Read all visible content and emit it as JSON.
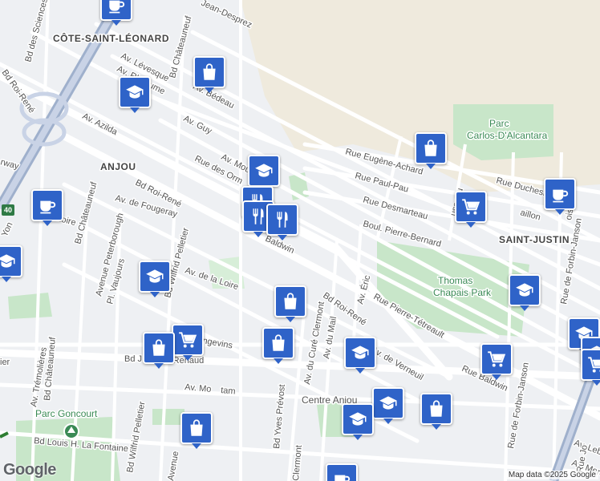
{
  "neighbourhoods": {
    "cote_saint_leonard": "CÔTE-SAINT-LÉONARD",
    "anjou": "ANJOU",
    "saint_justin": "SAINT-JUSTIN"
  },
  "parks": {
    "alcantara": "Parc\nCarlos-D'Alcantara",
    "thomas_chapais": "Thomas\nChapais Park",
    "goncourt": "Parc Goncourt",
    "centre_anjou": "Centre Anjou"
  },
  "streets": {
    "jean_desprez": "Jean-Desprez",
    "bd_sciences": "Bd des Sciences",
    "bd_chateauneuf_top": "Bd Châteauneuf",
    "av_levesque": "Av. Lévesque",
    "av_rheaume": "Av. Rhéaume",
    "av_bedeau": "Av. Bédeau",
    "bd_roi_rene_left": "Bd Roi-René",
    "av_azilda": "Av. Azilda",
    "av_guy": "Av. Guy",
    "av_mou": "Av. Mou",
    "rue_eugene_achard": "Rue Eugène-Achard",
    "rue_paul_pau": "Rue Paul-Pau",
    "rue_duchesne": "Rue Duchesn",
    "rue_desmarteau": "Rue Desmarteau",
    "bailon": "aillon",
    "usseau": "usseau",
    "boul_pierre_bernard": "Boul. Pierre-Bernard",
    "rue_des_orm": "Rue des Orm",
    "bd_roi_rene_mid": "Bd Roi-René",
    "highway": "rway",
    "anjou_small": "Yon",
    "av_fougeray": "Av. de Fougeray",
    "loire_left": "Loire",
    "bd_chateauneuf_mid": "Bd Châteauneuf",
    "avenue_peterborough": "Avenue Peterborough",
    "pl_vaujours": "Pl. Vaujours",
    "bd_wilfrid_pelletier": "Bd Wilfrid Pelletier",
    "av_loire": "Av. de la Loire",
    "baldwin": "Baldwin",
    "rue_pierre_tetreault": "Rue Pierre-Tétreault",
    "av_eric": "Av. Éric",
    "bd_roi_rene_right": "Bd Roi-René",
    "av_cure_clermont": "Av. du Curé Clermont",
    "av_du_mail": "Av. du Mail",
    "av_verneuil": "Av. de Verneuil",
    "rue_baldwin": "Rue Baldwin",
    "rue_forbin_janson": "Rue de Forbin-Janson",
    "rue_forbin_janson_top": "Rue de Forbin-Janson",
    "angevins": "ngevins",
    "bd_j_renaud": "Bd J",
    "renaud": "-Renaud",
    "bd_yves_prevost": "Bd Yves Prévost",
    "av_tremolieres": "Av. Trémolières",
    "bd_chateauneuf_low": "Bd Châteauneuf",
    "av_mo": "Av. Mo",
    "tam": "tam",
    "bd_louis_lafontaine": "Bd Louis H. La Fontaine",
    "bd_wilfrid_low": "Bd Wilfrid Pelletier",
    "clermont_low": "Clermont",
    "av_lebr": "Av. Lebr",
    "av_merc": "Av. Merc",
    "forbin_low": "Rue de Forbin-Janson",
    "pier": "ier",
    "avenue_low": "Avenue",
    "ois": "ois",
    "rue_jo": "Rue Jo"
  },
  "highway_shield": "40",
  "pois": [
    {
      "type": "cafe",
      "icon": "coffee-cup-icon"
    },
    {
      "type": "shopping",
      "icon": "shopping-bag-icon"
    },
    {
      "type": "school",
      "icon": "graduation-cap-icon"
    },
    {
      "type": "shopping",
      "icon": "shopping-bag-icon"
    },
    {
      "type": "school",
      "icon": "graduation-cap-icon"
    },
    {
      "type": "restaurant",
      "icon": "fork-knife-icon"
    },
    {
      "type": "restaurant",
      "icon": "fork-knife-icon"
    },
    {
      "type": "restaurant",
      "icon": "fork-knife-icon"
    },
    {
      "type": "grocery",
      "icon": "shopping-cart-icon"
    },
    {
      "type": "cafe",
      "icon": "coffee-cup-icon"
    },
    {
      "type": "cafe",
      "icon": "coffee-cup-icon"
    },
    {
      "type": "school",
      "icon": "graduation-cap-icon"
    },
    {
      "type": "school",
      "icon": "graduation-cap-icon"
    },
    {
      "type": "shopping",
      "icon": "shopping-bag-icon"
    },
    {
      "type": "grocery",
      "icon": "shopping-cart-icon"
    },
    {
      "type": "shopping",
      "icon": "shopping-bag-icon"
    },
    {
      "type": "shopping",
      "icon": "shopping-bag-icon"
    },
    {
      "type": "school",
      "icon": "graduation-cap-icon"
    },
    {
      "type": "school",
      "icon": "graduation-cap-icon"
    },
    {
      "type": "grocery",
      "icon": "shopping-cart-icon"
    },
    {
      "type": "school",
      "icon": "graduation-cap-icon"
    },
    {
      "type": "school",
      "icon": "graduation-cap-icon"
    },
    {
      "type": "school",
      "icon": "graduation-cap-icon"
    },
    {
      "type": "shopping",
      "icon": "shopping-bag-icon"
    },
    {
      "type": "shopping",
      "icon": "shopping-bag-icon"
    },
    {
      "type": "school",
      "icon": "graduation-cap-icon"
    },
    {
      "type": "grocery",
      "icon": "shopping-cart-icon"
    },
    {
      "type": "cafe",
      "icon": "coffee-cup-icon"
    }
  ],
  "attribution": "Map data ©2025 Google",
  "logo": "Google",
  "colors": {
    "marker": "#2f63c8",
    "park": "#c8e6c9",
    "road": "#ffffff",
    "background": "#eef0f3",
    "highway": "#8fa3c2"
  }
}
